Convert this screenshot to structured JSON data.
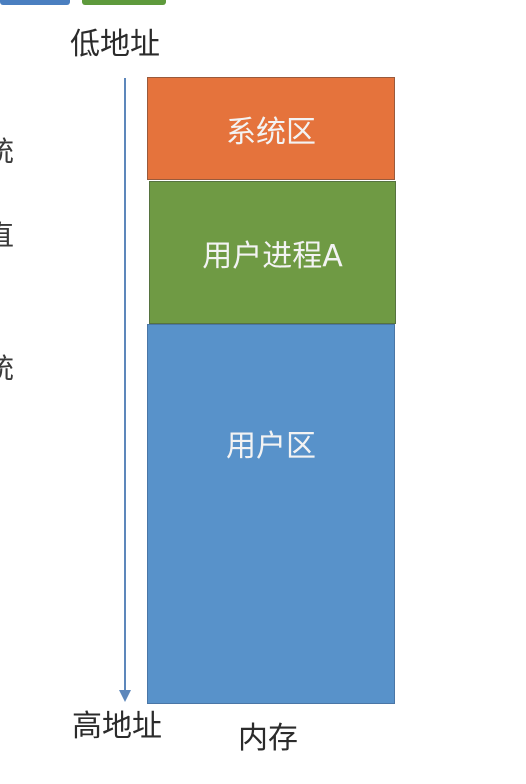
{
  "colors": {
    "system_area": "#E5733C",
    "user_process": "#6F9A44",
    "user_area": "#5892CA",
    "arrow": "#5D87BB",
    "top_tab_blue": "#4A7FC0",
    "top_tab_green": "#5E9A3C"
  },
  "labels": {
    "low_address": "低地址",
    "high_address": "高地址",
    "memory": "内存"
  },
  "blocks": {
    "system_area": "系统区",
    "user_process": "用户进程A",
    "user_area": "用户区"
  },
  "clipped_left_chars": [
    "统",
    "直",
    "统"
  ]
}
